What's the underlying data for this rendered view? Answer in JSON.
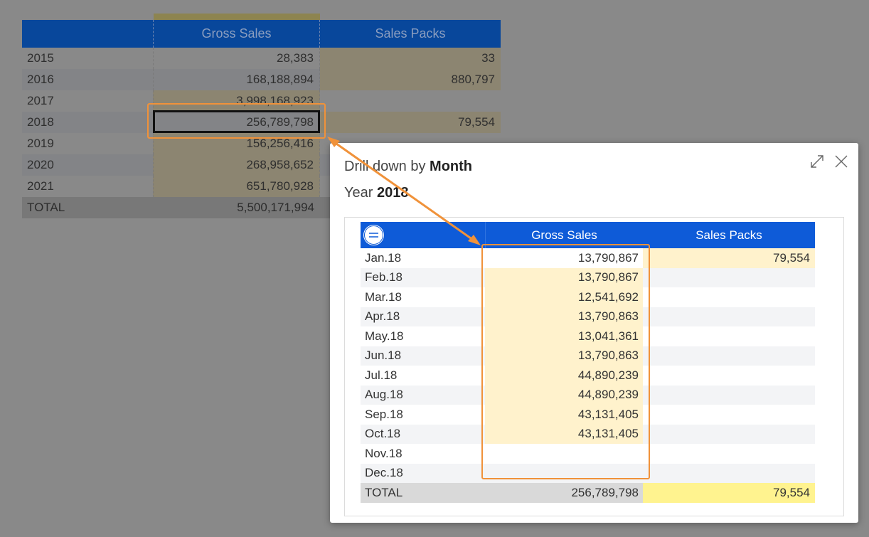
{
  "background_table": {
    "headers": [
      "",
      "Gross Sales",
      "Sales Packs"
    ],
    "rows": [
      {
        "year": "2015",
        "gross": "28,383",
        "packs": "33"
      },
      {
        "year": "2016",
        "gross": "168,188,894",
        "packs": "880,797"
      },
      {
        "year": "2017",
        "gross": "3,998,168,923",
        "packs": ""
      },
      {
        "year": "2018",
        "gross": "256,789,798",
        "packs": "79,554"
      },
      {
        "year": "2019",
        "gross": "156,256,416",
        "packs": ""
      },
      {
        "year": "2020",
        "gross": "268,958,652",
        "packs": ""
      },
      {
        "year": "2021",
        "gross": "651,780,928",
        "packs": ""
      }
    ],
    "total": {
      "label": "TOTAL",
      "gross": "5,500,171,994",
      "packs": ""
    }
  },
  "dialog": {
    "title_prefix": "Drill down by ",
    "title_dim": "Month",
    "sub_prefix": "Year ",
    "sub_value": "2018",
    "expand_icon": "expand-icon",
    "close_icon": "close-icon"
  },
  "drill_table": {
    "headers": [
      "",
      "Gross Sales",
      "Sales Packs"
    ],
    "rows": [
      {
        "month": "Jan.18",
        "gross": "13,790,867",
        "packs": "79,554"
      },
      {
        "month": "Feb.18",
        "gross": "13,790,867",
        "packs": ""
      },
      {
        "month": "Mar.18",
        "gross": "12,541,692",
        "packs": ""
      },
      {
        "month": "Apr.18",
        "gross": "13,790,863",
        "packs": ""
      },
      {
        "month": "May.18",
        "gross": "13,041,361",
        "packs": ""
      },
      {
        "month": "Jun.18",
        "gross": "13,790,863",
        "packs": ""
      },
      {
        "month": "Jul.18",
        "gross": "44,890,239",
        "packs": ""
      },
      {
        "month": "Aug.18",
        "gross": "44,890,239",
        "packs": ""
      },
      {
        "month": "Sep.18",
        "gross": "43,131,405",
        "packs": ""
      },
      {
        "month": "Oct.18",
        "gross": "43,131,405",
        "packs": ""
      },
      {
        "month": "Nov.18",
        "gross": "",
        "packs": ""
      },
      {
        "month": "Dec.18",
        "gross": "",
        "packs": ""
      }
    ],
    "total": {
      "label": "TOTAL",
      "gross": "256,789,798",
      "packs": "79,554"
    }
  },
  "colors": {
    "header_blue": "#0e5bd8",
    "highlight_yellow": "#fff2cc",
    "total_yellow": "#fff38f",
    "annotation_orange": "#f0923a"
  }
}
